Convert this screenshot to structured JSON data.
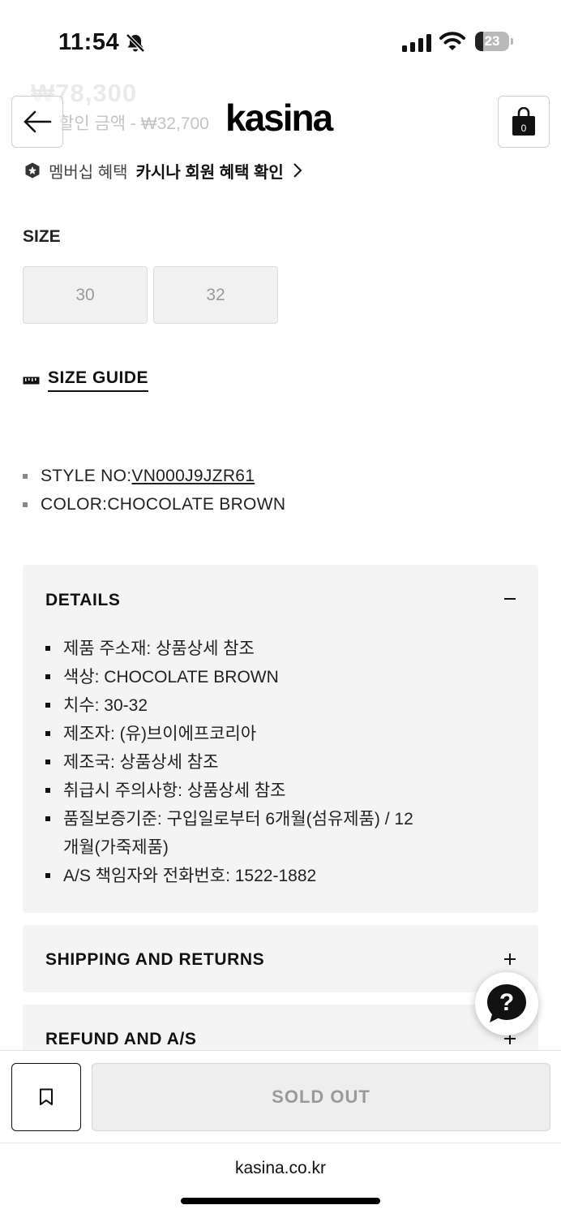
{
  "status_bar": {
    "time": "11:54",
    "battery": "23",
    "battery_level": 0.23,
    "icons": [
      "bell-slash-icon",
      "cellular-signal-icon",
      "wifi-icon",
      "battery-icon"
    ]
  },
  "header": {
    "ghost_price": "₩78,300",
    "ghost_discount": "할인 금액 - ₩32,700",
    "logo": "kasina",
    "cart_count": "0",
    "icons": [
      "back-arrow-icon",
      "shopping-bag-icon"
    ]
  },
  "membership": {
    "label": "멤버십 혜택",
    "link": "카시나 회원 혜택 확인",
    "icons": [
      "membership-badge-icon",
      "chevron-right-icon"
    ]
  },
  "size": {
    "label": "SIZE",
    "options": [
      "30",
      "32"
    ],
    "guide_label": "SIZE GUIDE",
    "guide_icon": "ruler-icon"
  },
  "specs": [
    {
      "label": "STYLE NO: ",
      "value": "VN000J9JZR61"
    },
    {
      "label": "COLOR: ",
      "value": "CHOCOLATE BROWN"
    }
  ],
  "details": {
    "title": "DETAILS",
    "expanded": true,
    "items": [
      "제품 주소재: 상품상세 참조",
      "색상: CHOCOLATE BROWN",
      "치수: 30-32",
      "제조자: (유)브이에프코리아",
      "제조국: 상품상세 참조",
      "취급시 주의사항: 상품상세 참조",
      "품질보증기준: 구입일로부터 6개월(섬유제품) / 12개월(가죽제품)",
      "A/S 책임자와 전화번호: 1522-1882"
    ]
  },
  "shipping": {
    "title": "SHIPPING AND RETURNS"
  },
  "refund": {
    "title": "REFUND AND A/S"
  },
  "actions": {
    "sold_out": "SOLD OUT",
    "icons": [
      "bookmark-icon",
      "help-chat-icon"
    ]
  },
  "browser": {
    "url": "kasina.co.kr"
  },
  "colors": {
    "accent": "#111111",
    "panel": "#f4f4f4",
    "disabled": "#9a9a9a"
  }
}
